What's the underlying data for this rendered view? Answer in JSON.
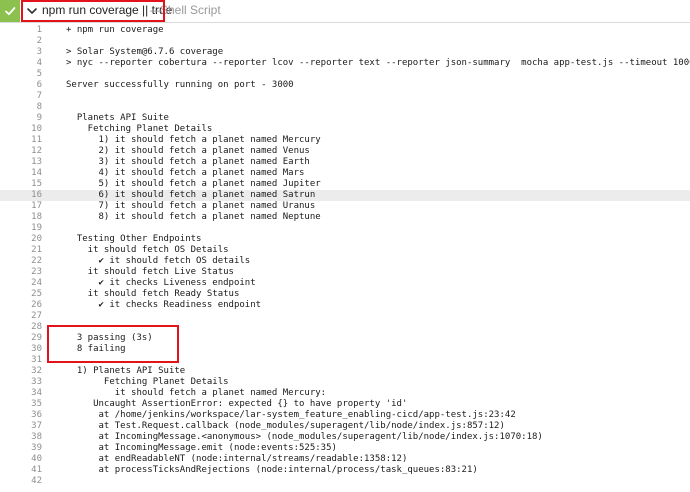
{
  "header": {
    "step_title": "npm run coverage || true",
    "separator": "—",
    "step_type": "Shell Script"
  },
  "colors": {
    "status_success": "#8cc04f",
    "highlight": "#e2131b",
    "active_line": "#ececec"
  },
  "active_line": 16,
  "log_lines": [
    {
      "n": "1",
      "t": "+ npm run coverage"
    },
    {
      "n": "2",
      "t": ""
    },
    {
      "n": "3",
      "t": "> Solar System@6.7.6 coverage"
    },
    {
      "n": "4",
      "t": "> nyc --reporter cobertura --reporter lcov --reporter text --reporter json-summary  mocha app-test.js --timeout 10000  --exit"
    },
    {
      "n": "5",
      "t": ""
    },
    {
      "n": "6",
      "t": "Server successfully running on port - 3000"
    },
    {
      "n": "7",
      "t": ""
    },
    {
      "n": "8",
      "t": ""
    },
    {
      "n": "9",
      "t": "  Planets API Suite"
    },
    {
      "n": "10",
      "t": "    Fetching Planet Details"
    },
    {
      "n": "11",
      "t": "      1) it should fetch a planet named Mercury"
    },
    {
      "n": "12",
      "t": "      2) it should fetch a planet named Venus"
    },
    {
      "n": "13",
      "t": "      3) it should fetch a planet named Earth"
    },
    {
      "n": "14",
      "t": "      4) it should fetch a planet named Mars"
    },
    {
      "n": "15",
      "t": "      5) it should fetch a planet named Jupiter"
    },
    {
      "n": "16",
      "t": "      6) it should fetch a planet named Satrun"
    },
    {
      "n": "17",
      "t": "      7) it should fetch a planet named Uranus"
    },
    {
      "n": "18",
      "t": "      8) it should fetch a planet named Neptune"
    },
    {
      "n": "19",
      "t": ""
    },
    {
      "n": "20",
      "t": "  Testing Other Endpoints"
    },
    {
      "n": "21",
      "t": "    it should fetch OS Details"
    },
    {
      "n": "22",
      "t": "      ✔ it should fetch OS details"
    },
    {
      "n": "23",
      "t": "    it should fetch Live Status"
    },
    {
      "n": "24",
      "t": "      ✔ it checks Liveness endpoint"
    },
    {
      "n": "25",
      "t": "    it should fetch Ready Status"
    },
    {
      "n": "26",
      "t": "      ✔ it checks Readiness endpoint"
    },
    {
      "n": "27",
      "t": ""
    },
    {
      "n": "28",
      "t": ""
    },
    {
      "n": "29",
      "t": "  3 passing (3s)"
    },
    {
      "n": "30",
      "t": "  8 failing"
    },
    {
      "n": "31",
      "t": ""
    },
    {
      "n": "32",
      "t": "  1) Planets API Suite"
    },
    {
      "n": "33",
      "t": "       Fetching Planet Details"
    },
    {
      "n": "34",
      "t": "         it should fetch a planet named Mercury:"
    },
    {
      "n": "35",
      "t": "     Uncaught AssertionError: expected {} to have property 'id'"
    },
    {
      "n": "36",
      "t": "      at /home/jenkins/workspace/lar-system_feature_enabling-cicd/app-test.js:23:42"
    },
    {
      "n": "37",
      "t": "      at Test.Request.callback (node_modules/superagent/lib/node/index.js:857:12)"
    },
    {
      "n": "38",
      "t": "      at IncomingMessage.<anonymous> (node_modules/superagent/lib/node/index.js:1070:18)"
    },
    {
      "n": "39",
      "t": "      at IncomingMessage.emit (node:events:525:35)"
    },
    {
      "n": "40",
      "t": "      at endReadableNT (node:internal/streams/readable:1358:12)"
    },
    {
      "n": "41",
      "t": "      at processTicksAndRejections (node:internal/process/task_queues:83:21)"
    },
    {
      "n": "42",
      "t": ""
    }
  ]
}
